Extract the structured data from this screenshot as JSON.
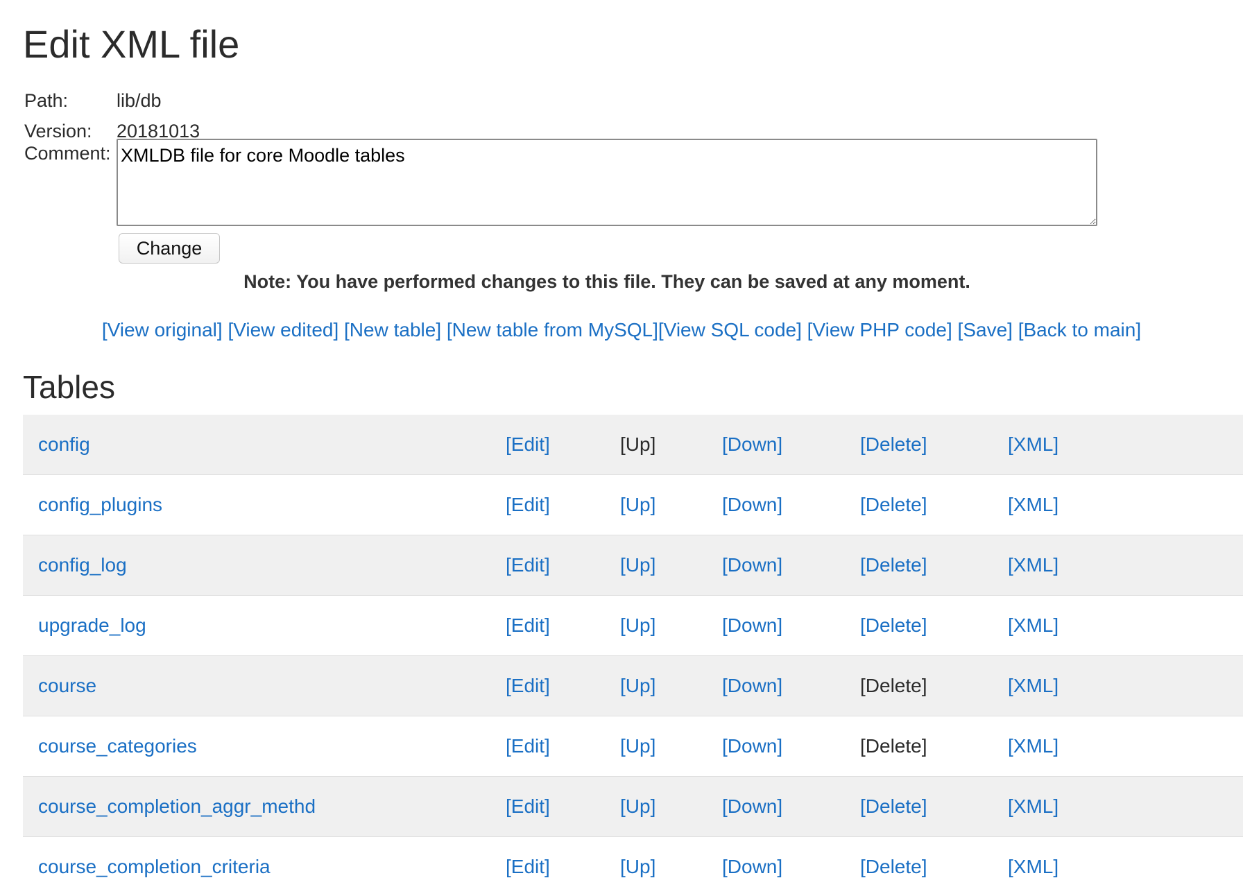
{
  "page_title": "Edit XML file",
  "meta": {
    "path_label": "Path:",
    "path_value": "lib/db",
    "version_label": "Version:",
    "version_value": "20181013",
    "comment_label": "Comment:",
    "comment_value": "XMLDB file for core Moodle tables"
  },
  "change_button_label": "Change",
  "note": "Note: You have performed changes to this file. They can be saved at any moment.",
  "actions": {
    "view_original": "[View original]",
    "view_edited": "[View edited]",
    "new_table": "[New table]",
    "new_table_from_mysql": "[New table from MySQL]",
    "view_sql_code": "[View SQL code]",
    "view_php_code": "[View PHP code]",
    "save": "[Save]",
    "back_to_main": "[Back to main]"
  },
  "tables_heading": "Tables",
  "row_actions": {
    "edit": "[Edit]",
    "up": "[Up]",
    "down": "[Down]",
    "delete": "[Delete]",
    "xml": "[XML]"
  },
  "tables": [
    {
      "name": "config"
    },
    {
      "name": "config_plugins"
    },
    {
      "name": "config_log"
    },
    {
      "name": "upgrade_log"
    },
    {
      "name": "course"
    },
    {
      "name": "course_categories"
    },
    {
      "name": "course_completion_aggr_methd"
    },
    {
      "name": "course_completion_criteria"
    }
  ]
}
